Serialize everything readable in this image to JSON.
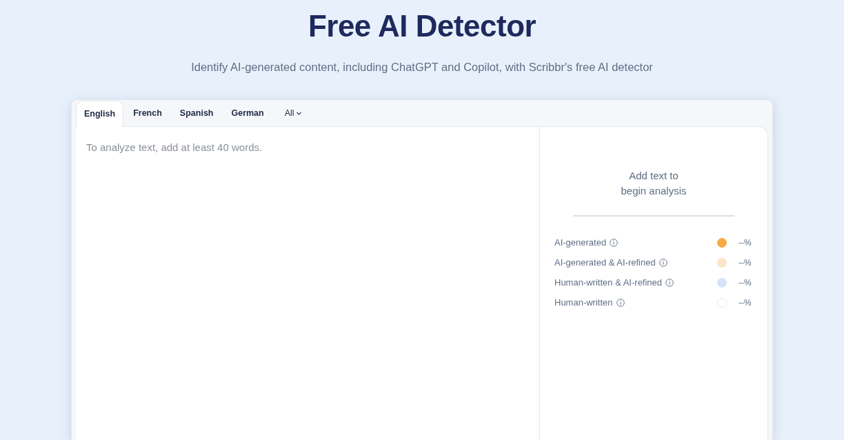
{
  "header": {
    "title": "Free AI Detector",
    "subtitle": "Identify AI-generated content, including ChatGPT and Copilot, with Scribbr's free AI detector"
  },
  "tabs": [
    {
      "label": "English",
      "selected": true,
      "kind": "tab"
    },
    {
      "label": "French",
      "selected": false,
      "kind": "tab"
    },
    {
      "label": "Spanish",
      "selected": false,
      "kind": "tab"
    },
    {
      "label": "German",
      "selected": false,
      "kind": "tab"
    },
    {
      "label": "All",
      "selected": false,
      "kind": "dropdown"
    }
  ],
  "editor": {
    "placeholder": "To analyze text, add at least 40 words."
  },
  "results": {
    "message": "Add text to begin analysis",
    "legend": [
      {
        "label": "AI-generated",
        "color": "#f7a944",
        "value": "--%"
      },
      {
        "label": "AI-generated & AI-refined",
        "color": "#fde4c8",
        "value": "--%"
      },
      {
        "label": "Human-written & AI-refined",
        "color": "#d5e3fa",
        "value": "--%"
      },
      {
        "label": "Human-written",
        "color": "#ffffff",
        "value": "--%"
      }
    ]
  }
}
